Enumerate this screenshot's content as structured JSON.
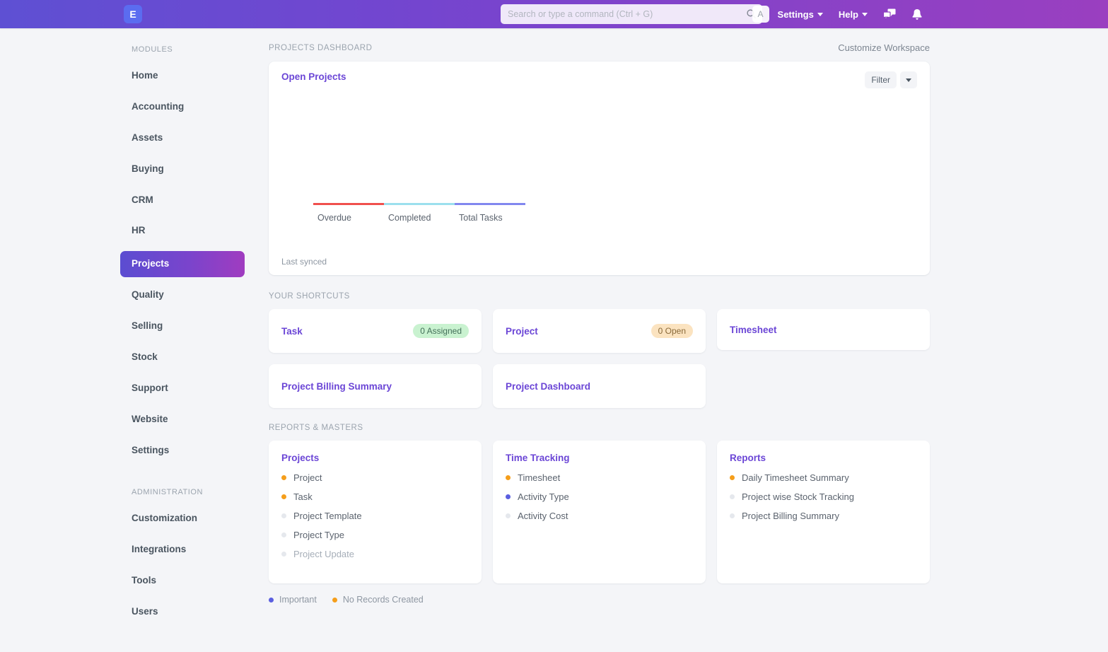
{
  "navbar": {
    "logo_text": "E",
    "search": {
      "placeholder": "Search or type a command (Ctrl + G)",
      "value": ""
    },
    "avatar_initial": "A",
    "settings_label": "Settings",
    "help_label": "Help",
    "icons": [
      "chat-icon",
      "bell-icon"
    ],
    "gradient_from": "#5e50d3",
    "gradient_to": "#9a3fc0"
  },
  "sidebar": {
    "modules_heading": "MODULES",
    "modules": [
      {
        "label": "Home",
        "active": false
      },
      {
        "label": "Accounting",
        "active": false
      },
      {
        "label": "Assets",
        "active": false
      },
      {
        "label": "Buying",
        "active": false
      },
      {
        "label": "CRM",
        "active": false
      },
      {
        "label": "HR",
        "active": false
      },
      {
        "label": "Projects",
        "active": true
      },
      {
        "label": "Quality",
        "active": false
      },
      {
        "label": "Selling",
        "active": false
      },
      {
        "label": "Stock",
        "active": false
      },
      {
        "label": "Support",
        "active": false
      },
      {
        "label": "Website",
        "active": false
      },
      {
        "label": "Settings",
        "active": false
      }
    ],
    "administration_heading": "ADMINISTRATION",
    "administration": [
      {
        "label": "Customization"
      },
      {
        "label": "Integrations"
      },
      {
        "label": "Tools"
      },
      {
        "label": "Users"
      }
    ]
  },
  "main": {
    "page_label": "PROJECTS DASHBOARD",
    "customize_link": "Customize Workspace",
    "chart_card": {
      "title": "Open Projects",
      "filter_label": "Filter",
      "last_synced": "Last synced"
    },
    "shortcuts_label": "YOUR SHORTCUTS",
    "shortcuts": [
      {
        "label": "Task",
        "badge": "0 Assigned",
        "badge_color": "green"
      },
      {
        "label": "Project",
        "badge": "0 Open",
        "badge_color": "orange"
      },
      {
        "label": "Timesheet",
        "badge": "",
        "badge_color": ""
      },
      {
        "label": "Project Billing Summary",
        "badge": "",
        "badge_color": ""
      },
      {
        "label": "Project Dashboard",
        "badge": "",
        "badge_color": ""
      }
    ],
    "reports_label": "REPORTS & MASTERS",
    "reports_cards": [
      {
        "title": "Projects",
        "items": [
          {
            "label": "Project",
            "dot": "orange",
            "muted": false
          },
          {
            "label": "Task",
            "dot": "orange",
            "muted": false
          },
          {
            "label": "Project Template",
            "dot": "grey",
            "muted": false
          },
          {
            "label": "Project Type",
            "dot": "grey",
            "muted": false
          },
          {
            "label": "Project Update",
            "dot": "grey",
            "muted": true
          }
        ]
      },
      {
        "title": "Time Tracking",
        "items": [
          {
            "label": "Timesheet",
            "dot": "orange",
            "muted": false
          },
          {
            "label": "Activity Type",
            "dot": "blue",
            "muted": false
          },
          {
            "label": "Activity Cost",
            "dot": "grey",
            "muted": false
          }
        ]
      },
      {
        "title": "Reports",
        "items": [
          {
            "label": "Daily Timesheet Summary",
            "dot": "orange",
            "muted": false
          },
          {
            "label": "Project wise Stock Tracking",
            "dot": "grey",
            "muted": false
          },
          {
            "label": "Project Billing Summary",
            "dot": "grey",
            "muted": false
          }
        ]
      }
    ],
    "legend": [
      {
        "label": "Important",
        "dot": "blue"
      },
      {
        "label": "No Records Created",
        "dot": "orange"
      }
    ]
  },
  "chart_data": {
    "type": "bar",
    "title": "Open Projects",
    "categories": [
      "Overdue",
      "Completed",
      "Total Tasks"
    ],
    "values": [
      0,
      0,
      0
    ],
    "colors": [
      "#f0504d",
      "#9ce0ee",
      "#8187ef"
    ],
    "xlabel": "",
    "ylabel": "",
    "ylim": [
      0,
      0
    ],
    "grid": false,
    "legend_position": "none",
    "annotation": "Last synced"
  }
}
